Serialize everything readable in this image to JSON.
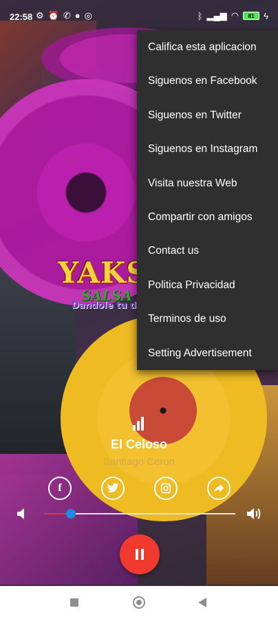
{
  "status_bar": {
    "time": "22:58",
    "battery": "81",
    "left_icons": [
      "gear-icon",
      "alarm-icon",
      "whatsapp-icon",
      "dot-icon",
      "instagram-icon"
    ],
    "right_icons": [
      "bluetooth-icon",
      "signal-icon",
      "wifi-icon",
      "battery-icon",
      "charging-icon"
    ]
  },
  "logo": {
    "brand": "YAKS",
    "subtitle": "SALSA",
    "tagline": "Dandole tu dosis"
  },
  "menu": {
    "items": [
      "Califica esta aplicacion",
      "Siguenos en Facebook",
      "Siguenos en Twitter",
      "Siguenos en Instagram",
      "Visita nuestra Web",
      "Compartir con amigos",
      "Contact us",
      "Politica Privacidad",
      "Terminos de uso",
      "Setting Advertisement"
    ]
  },
  "player": {
    "title": "El Celoso",
    "artist": "Santiago Ceron",
    "volume_level": 0.14,
    "accent_colors": {
      "pause_button": "#f03a2e",
      "slider_fill": "#e53a2b",
      "slider_thumb": "#1e88e5"
    }
  },
  "social_icons": [
    "facebook-icon",
    "twitter-icon",
    "instagram-icon",
    "share-icon"
  ],
  "nav_icons": [
    "recents-icon",
    "home-icon",
    "back-icon"
  ]
}
